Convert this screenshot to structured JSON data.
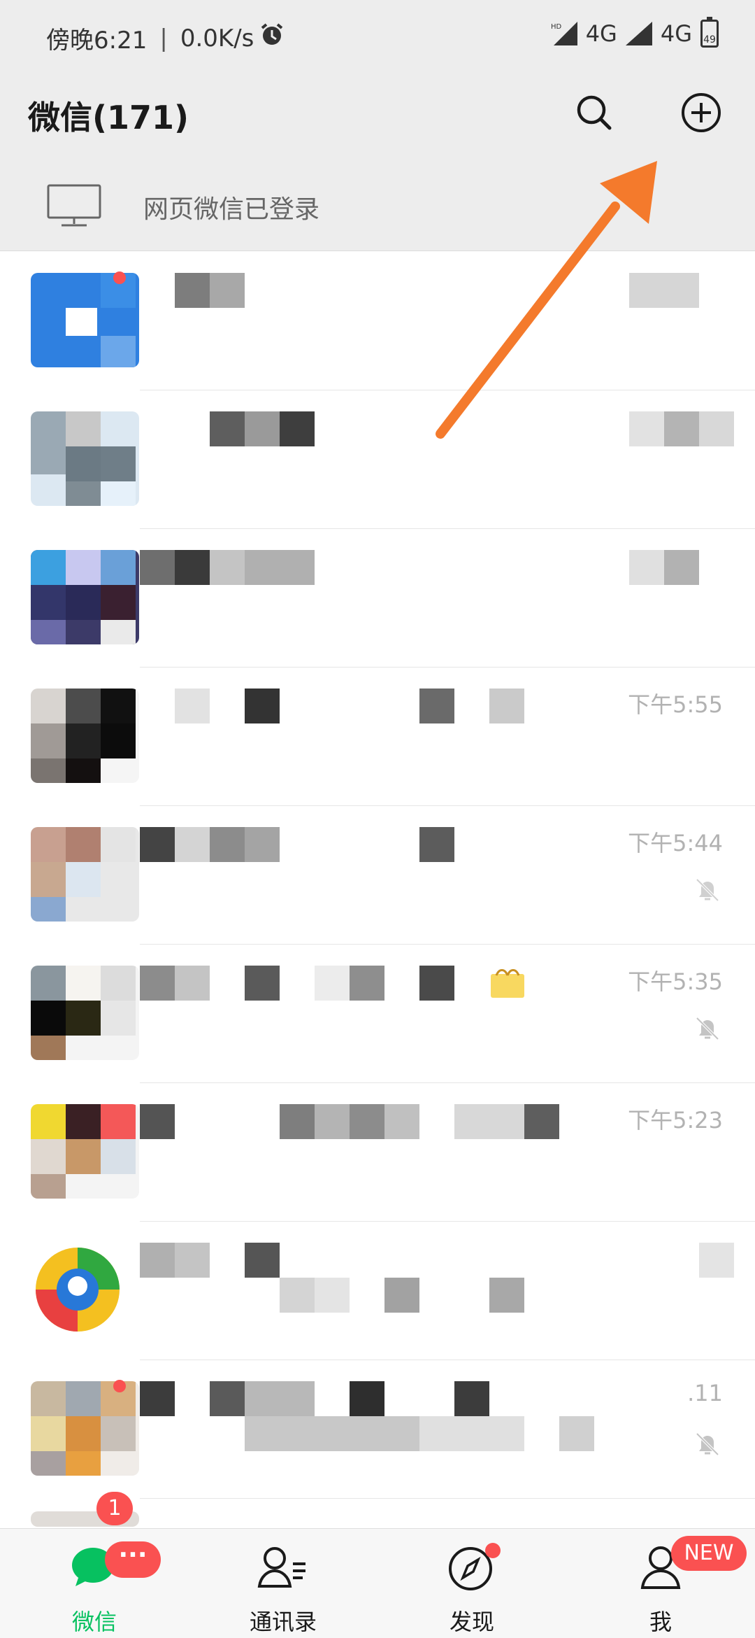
{
  "status_bar": {
    "time": "傍晚6:21",
    "speed": "0.0K/s",
    "network1": "4G",
    "network2": "4G",
    "battery": "49"
  },
  "header": {
    "title": "微信(171)"
  },
  "web_login": {
    "text": "网页微信已登录"
  },
  "chats": [
    {
      "time": "",
      "muted": false
    },
    {
      "time": "",
      "muted": false
    },
    {
      "time": "",
      "muted": false
    },
    {
      "time": "下午5:55",
      "muted": false
    },
    {
      "time": "下午5:44",
      "muted": true
    },
    {
      "time": "下午5:35",
      "muted": true
    },
    {
      "time": "下午5:23",
      "muted": false
    },
    {
      "time": "",
      "muted": false
    },
    {
      "time": ".11",
      "muted": true
    }
  ],
  "tabbar": {
    "tabs": [
      {
        "label": "微信",
        "active": true,
        "badge": "···"
      },
      {
        "label": "通讯录",
        "active": false
      },
      {
        "label": "发现",
        "active": false,
        "dot": true
      },
      {
        "label": "我",
        "active": false,
        "badge": "NEW"
      }
    ]
  },
  "partial_badge": "1",
  "colors": {
    "accent": "#07c160",
    "badge": "#fa5151",
    "arrow": "#f47a2c",
    "header_bg": "#ededed"
  }
}
